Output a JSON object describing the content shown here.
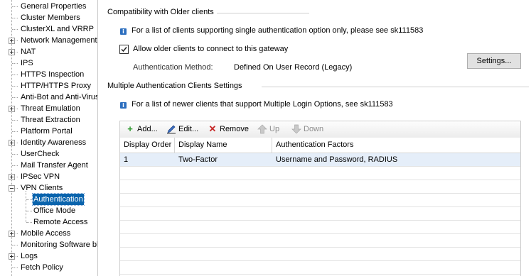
{
  "tree": {
    "items": [
      {
        "label": "General Properties",
        "expander": "none",
        "level": 0
      },
      {
        "label": "Cluster Members",
        "expander": "none",
        "level": 0
      },
      {
        "label": "ClusterXL and VRRP",
        "expander": "none",
        "level": 0
      },
      {
        "label": "Network Management",
        "expander": "plus",
        "level": 0
      },
      {
        "label": "NAT",
        "expander": "plus",
        "level": 0
      },
      {
        "label": "IPS",
        "expander": "none",
        "level": 0
      },
      {
        "label": "HTTPS Inspection",
        "expander": "none",
        "level": 0
      },
      {
        "label": "HTTP/HTTPS Proxy",
        "expander": "none",
        "level": 0
      },
      {
        "label": "Anti-Bot and Anti-Virus",
        "expander": "none",
        "level": 0
      },
      {
        "label": "Threat Emulation",
        "expander": "plus",
        "level": 0
      },
      {
        "label": "Threat Extraction",
        "expander": "none",
        "level": 0
      },
      {
        "label": "Platform Portal",
        "expander": "none",
        "level": 0
      },
      {
        "label": "Identity Awareness",
        "expander": "plus",
        "level": 0
      },
      {
        "label": "UserCheck",
        "expander": "none",
        "level": 0
      },
      {
        "label": "Mail Transfer Agent",
        "expander": "none",
        "level": 0
      },
      {
        "label": "IPSec VPN",
        "expander": "plus",
        "level": 0
      },
      {
        "label": "VPN Clients",
        "expander": "minus",
        "level": 0
      },
      {
        "label": "Authentication",
        "expander": "none",
        "level": 1,
        "selected": true
      },
      {
        "label": "Office Mode",
        "expander": "none",
        "level": 1
      },
      {
        "label": "Remote Access",
        "expander": "none",
        "level": 1
      },
      {
        "label": "Mobile Access",
        "expander": "plus",
        "level": 0
      },
      {
        "label": "Monitoring Software bla",
        "expander": "none",
        "level": 0
      },
      {
        "label": "Logs",
        "expander": "plus",
        "level": 0
      },
      {
        "label": "Fetch Policy",
        "expander": "none",
        "level": 0
      }
    ]
  },
  "compat": {
    "title": "Compatibility with Older clients",
    "info": "For a list of clients supporting single authentication option only, please see sk111583",
    "checkbox_label": "Allow older clients to connect to this gateway",
    "checked": true,
    "method_label": "Authentication Method:",
    "method_value": "Defined On User Record (Legacy)",
    "settings_button": "Settings..."
  },
  "multi": {
    "title": "Multiple Authentication Clients Settings",
    "info": "For a list of newer clients that support Multiple Login Options, see sk111583"
  },
  "toolbar": {
    "add": "Add...",
    "edit": "Edit...",
    "remove": "Remove",
    "up": "Up",
    "down": "Down"
  },
  "grid": {
    "headers": [
      "Display Order",
      "Display Name",
      "Authentication Factors"
    ],
    "rows": [
      [
        "1",
        "Two-Factor",
        "Username and Password, RADIUS"
      ]
    ]
  },
  "colors": {
    "selection": "#0a64ad",
    "info_icon": "#2d6fbf",
    "add_icon": "#2e9a2e",
    "remove_icon": "#c62828"
  },
  "icons": {
    "info": "info-icon",
    "add": "plus-icon",
    "edit": "pencil-icon",
    "remove": "x-icon",
    "up": "up-arrow-icon",
    "down": "down-arrow-icon"
  }
}
